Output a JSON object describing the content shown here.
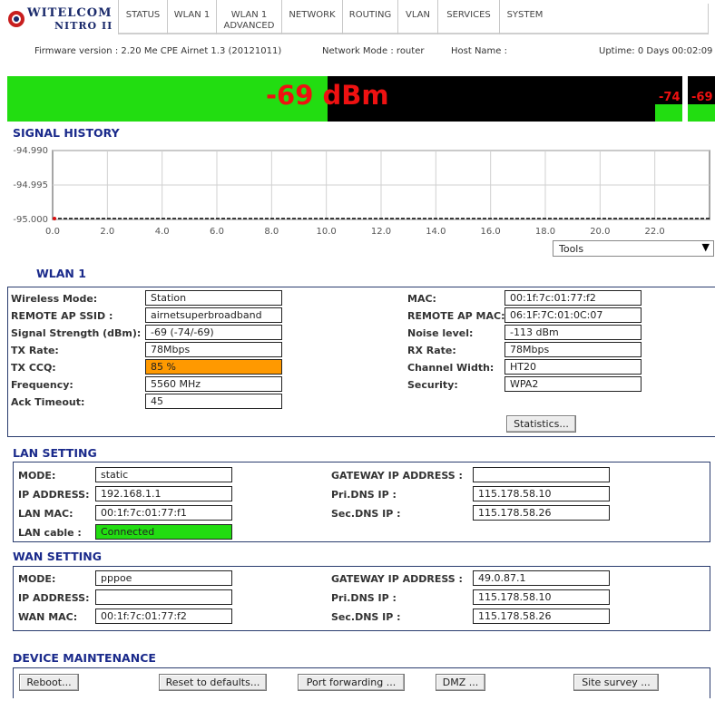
{
  "header": {
    "logo_text": "WITELCOM",
    "logo_sub": "NITRO II",
    "nav": [
      {
        "l1": "STATUS",
        "l2": ""
      },
      {
        "l1": "WLAN 1",
        "l2": ""
      },
      {
        "l1": "WLAN 1",
        "l2": "ADVANCED"
      },
      {
        "l1": "NETWORK",
        "l2": ""
      },
      {
        "l1": "ROUTING",
        "l2": ""
      },
      {
        "l1": "VLAN",
        "l2": ""
      },
      {
        "l1": "SERVICES",
        "l2": ""
      },
      {
        "l1": "SYSTEM",
        "l2": ""
      }
    ]
  },
  "info": {
    "firmware_label": "Firmware version :",
    "firmware_value": "2.20 Me CPE Airnet 1.3 (20121011)",
    "mode_label": "Network Mode :",
    "mode_value": "router",
    "host_label": "Host Name :",
    "host_value": "",
    "uptime_label": "Uptime:",
    "uptime_value": "0 Days 00:02:09"
  },
  "signal": {
    "main": "-69 dBm",
    "main_level_fraction": 0.5,
    "chain1": "-74",
    "chain2": "-69",
    "colors": {
      "good": "#22dd11",
      "text": "#ee1111"
    }
  },
  "signal_history": {
    "title": "SIGNAL HISTORY",
    "tools_label": "Tools",
    "tools_arrow": "▼"
  },
  "chart_data": {
    "type": "line",
    "title": "",
    "xlabel": "",
    "ylabel": "",
    "x_ticks": [
      "0.0",
      "2.0",
      "4.0",
      "6.0",
      "8.0",
      "10.0",
      "12.0",
      "14.0",
      "16.0",
      "18.0",
      "20.0",
      "22.0"
    ],
    "y_ticks": [
      "-94.990",
      "-94.995",
      "-95.000"
    ],
    "xlim": [
      0,
      24
    ],
    "ylim": [
      -95.0,
      -94.99
    ],
    "grid": true,
    "series": [
      {
        "name": "",
        "x": [
          0,
          24
        ],
        "y": [
          -95.0,
          -95.0
        ]
      }
    ]
  },
  "wlan": {
    "title": "WLAN 1",
    "left": [
      {
        "label": "Wireless Mode:",
        "value": "Station"
      },
      {
        "label": "REMOTE AP SSID :",
        "value": "airnetsuperbroadband"
      },
      {
        "label": "Signal Strength (dBm):",
        "value": "-69 (-74/-69)"
      },
      {
        "label": "TX Rate:",
        "value": "78Mbps"
      },
      {
        "label": "TX CCQ:",
        "value": "85 %",
        "color": "#ff9900"
      },
      {
        "label": "Frequency:",
        "value": "5560 MHz"
      },
      {
        "label": "Ack Timeout:",
        "value": "45"
      }
    ],
    "right": [
      {
        "label": "MAC:",
        "value": "00:1f:7c:01:77:f2"
      },
      {
        "label": "REMOTE AP MAC:",
        "value": "06:1F:7C:01:0C:07"
      },
      {
        "label": "Noise level:",
        "value": "-113 dBm"
      },
      {
        "label": "RX Rate:",
        "value": "78Mbps"
      },
      {
        "label": "Channel Width:",
        "value": "HT20"
      },
      {
        "label": "Security:",
        "value": "WPA2"
      }
    ],
    "statistics_button": "Statistics..."
  },
  "lan": {
    "title": "LAN SETTING",
    "left": [
      {
        "label": "MODE:",
        "value": "static"
      },
      {
        "label": "IP ADDRESS:",
        "value": "192.168.1.1"
      },
      {
        "label": "LAN MAC:",
        "value": "00:1f:7c:01:77:f1"
      },
      {
        "label": "LAN cable :",
        "value": "Connected",
        "color": "#22dd11"
      }
    ],
    "right": [
      {
        "label": "GATEWAY IP ADDRESS :",
        "value": ""
      },
      {
        "label": "Pri.DNS IP :",
        "value": "115.178.58.10"
      },
      {
        "label": "Sec.DNS IP :",
        "value": "115.178.58.26"
      }
    ]
  },
  "wan": {
    "title": "WAN SETTING",
    "left": [
      {
        "label": "MODE:",
        "value": "pppoe"
      },
      {
        "label": "IP ADDRESS:",
        "value": ""
      },
      {
        "label": "WAN MAC:",
        "value": "00:1f:7c:01:77:f2"
      }
    ],
    "right": [
      {
        "label": "GATEWAY IP ADDRESS :",
        "value": "49.0.87.1"
      },
      {
        "label": "Pri.DNS IP :",
        "value": "115.178.58.10"
      },
      {
        "label": "Sec.DNS IP :",
        "value": "115.178.58.26"
      }
    ]
  },
  "maintenance": {
    "title": "DEVICE MAINTENANCE",
    "buttons": [
      "Reboot...",
      "Reset to defaults...",
      "Port forwarding ...",
      "DMZ ...",
      "Site survey ..."
    ]
  }
}
